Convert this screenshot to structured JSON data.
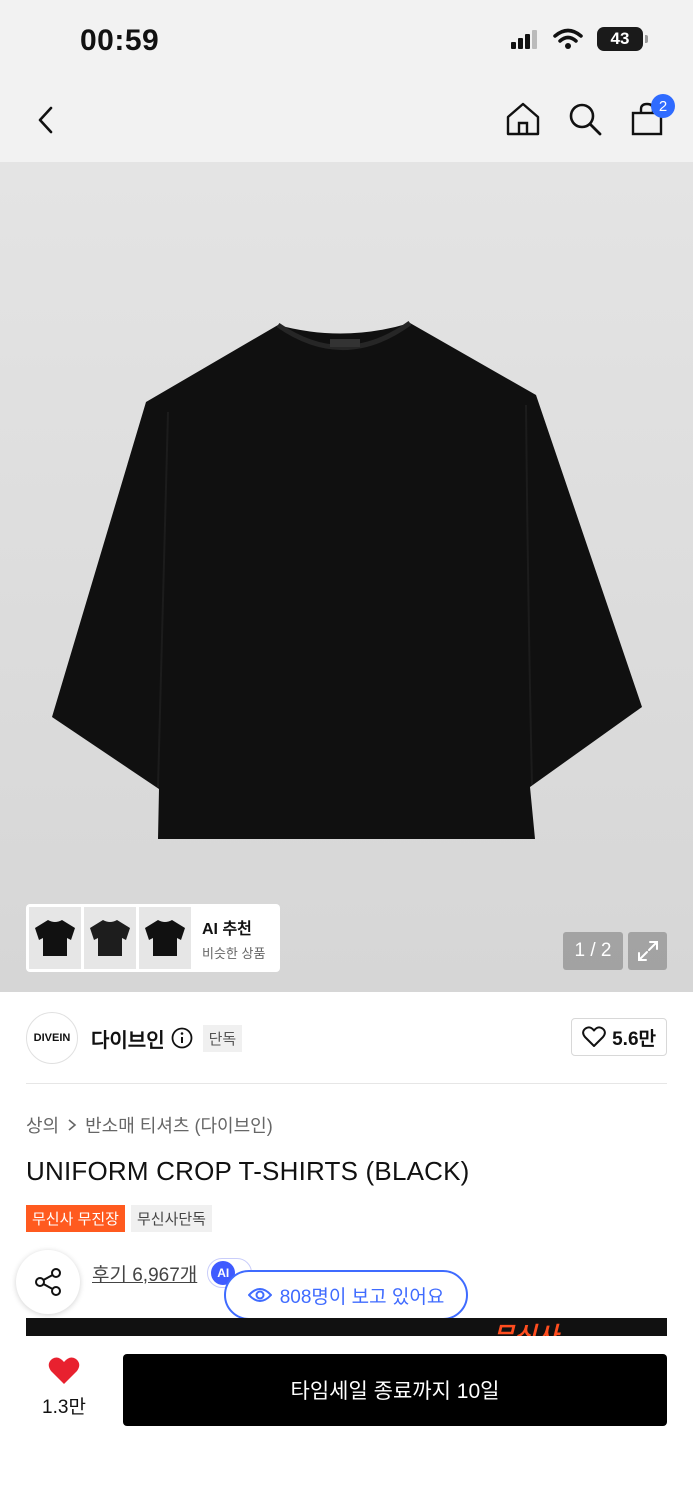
{
  "status_bar": {
    "time": "00:59",
    "battery": "43"
  },
  "nav": {
    "cart_count": "2"
  },
  "gallery": {
    "ai_rec_title": "AI 추천",
    "ai_rec_sub": "비슷한 상품",
    "counter": "1 / 2"
  },
  "brand": {
    "logo_text": "DIVEIN",
    "name": "다이브인",
    "tag": "단독",
    "likes": "5.6만"
  },
  "product": {
    "breadcrumb": [
      "상의",
      "반소매 티셔츠 (다이브인)"
    ],
    "title": "UNIFORM CROP T-SHIRTS (BLACK)",
    "tags": [
      "무신사 무진장",
      "무신사단독"
    ],
    "review_link": "후기 6,967개",
    "ai_pill_label": "AI",
    "viewers": "808명이 보고 있어요",
    "promo_text": "무신사"
  },
  "bottom_bar": {
    "wish_count": "1.3만",
    "cta": "타임세일 종료까지 10일"
  },
  "colors": {
    "accent_blue": "#3f6bff",
    "tag_orange": "#ff5a1f",
    "heart_red": "#e8212f"
  },
  "icons": [
    "back-icon",
    "home-icon",
    "search-icon",
    "cart-icon",
    "expand-icon",
    "info-icon",
    "heart-outline-icon",
    "share-icon",
    "eye-icon",
    "heart-filled-icon"
  ]
}
